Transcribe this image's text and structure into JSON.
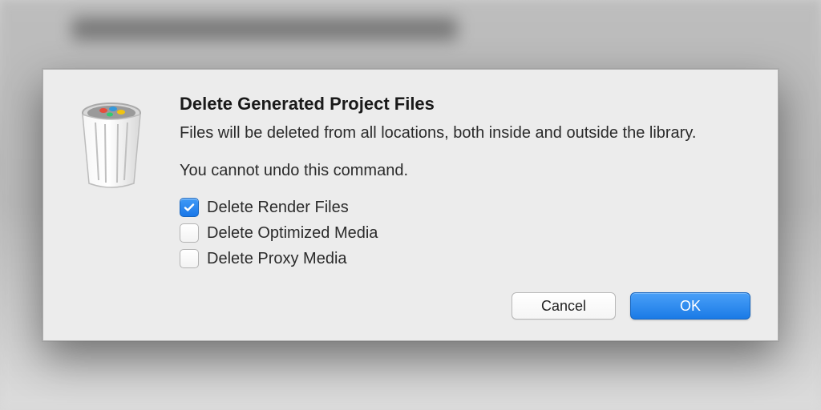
{
  "dialog": {
    "title": "Delete Generated Project Files",
    "description": "Files will be deleted from all locations, both inside and outside the library.",
    "warning": "You cannot undo this command.",
    "options": [
      {
        "label": "Delete Render Files",
        "checked": true
      },
      {
        "label": "Delete Optimized Media",
        "checked": false
      },
      {
        "label": "Delete Proxy Media",
        "checked": false
      }
    ],
    "buttons": {
      "cancel": "Cancel",
      "ok": "OK"
    }
  },
  "icons": {
    "trash": "trash-icon"
  }
}
